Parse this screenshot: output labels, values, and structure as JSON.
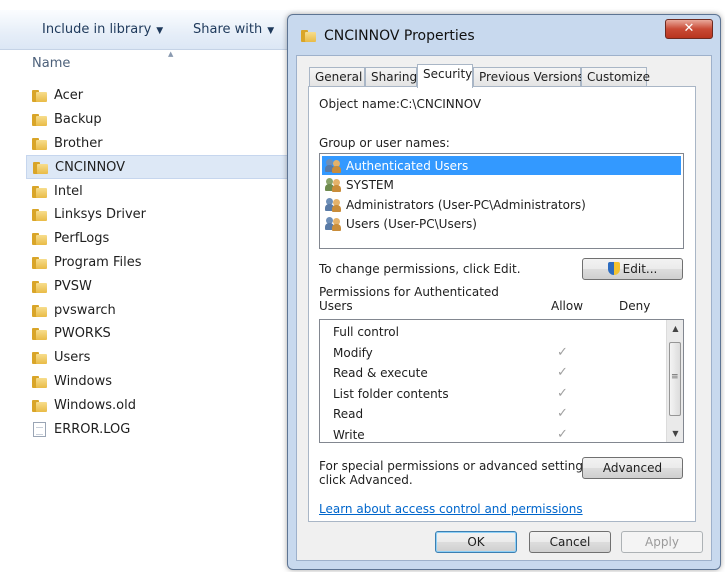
{
  "explorer": {
    "toolbar": {
      "include_in_library": "Include in library",
      "share_with": "Share with"
    },
    "column_header": "Name",
    "files": [
      {
        "name": "Acer",
        "type": "folder"
      },
      {
        "name": "Backup",
        "type": "folder"
      },
      {
        "name": "Brother",
        "type": "folder"
      },
      {
        "name": "CNCINNOV",
        "type": "folder",
        "selected": true
      },
      {
        "name": "Intel",
        "type": "folder"
      },
      {
        "name": "Linksys Driver",
        "type": "folder"
      },
      {
        "name": "PerfLogs",
        "type": "folder"
      },
      {
        "name": "Program Files",
        "type": "folder"
      },
      {
        "name": "PVSW",
        "type": "folder"
      },
      {
        "name": "pvswarch",
        "type": "folder"
      },
      {
        "name": "PWORKS",
        "type": "folder"
      },
      {
        "name": "Users",
        "type": "folder"
      },
      {
        "name": "Windows",
        "type": "folder"
      },
      {
        "name": "Windows.old",
        "type": "folder"
      },
      {
        "name": "ERROR.LOG",
        "type": "file"
      }
    ]
  },
  "dialog": {
    "title": "CNCINNOV Properties",
    "close_glyph": "✕",
    "tabs": [
      "General",
      "Sharing",
      "Security",
      "Previous Versions",
      "Customize"
    ],
    "active_tab": "Security",
    "object_name_label": "Object name:",
    "object_name_value": "C:\\CNCINNOV",
    "group_label": "Group or user names:",
    "users": [
      {
        "name": "Authenticated Users",
        "selected": true,
        "icon": "users-group-icon"
      },
      {
        "name": "SYSTEM",
        "icon": "system-user-icon"
      },
      {
        "name": "Administrators (User-PC\\Administrators)",
        "icon": "users-group-icon"
      },
      {
        "name": "Users (User-PC\\Users)",
        "icon": "users-group-icon"
      }
    ],
    "change_permissions_text": "To change permissions, click Edit.",
    "edit_button": "Edit...",
    "permissions_for_label_line1": "Permissions for Authenticated",
    "permissions_for_label_line2": "Users",
    "allow_header": "Allow",
    "deny_header": "Deny",
    "permissions": [
      {
        "name": "Full control",
        "allow": false,
        "deny": false
      },
      {
        "name": "Modify",
        "allow": true,
        "deny": false
      },
      {
        "name": "Read & execute",
        "allow": true,
        "deny": false
      },
      {
        "name": "List folder contents",
        "allow": true,
        "deny": false
      },
      {
        "name": "Read",
        "allow": true,
        "deny": false
      },
      {
        "name": "Write",
        "allow": true,
        "deny": false
      }
    ],
    "check_glyph": "✓",
    "special_permissions_line1": "For special permissions or advanced settings,",
    "special_permissions_line2": "click Advanced.",
    "advanced_button": "Advanced",
    "learn_link": "Learn about access control and permissions",
    "ok_button": "OK",
    "cancel_button": "Cancel",
    "apply_button": "Apply"
  },
  "colors": {
    "selection": "#3399ff",
    "link": "#0066cc",
    "close_button": "#c94a35",
    "dialog_frame": "#c8d9ee"
  }
}
